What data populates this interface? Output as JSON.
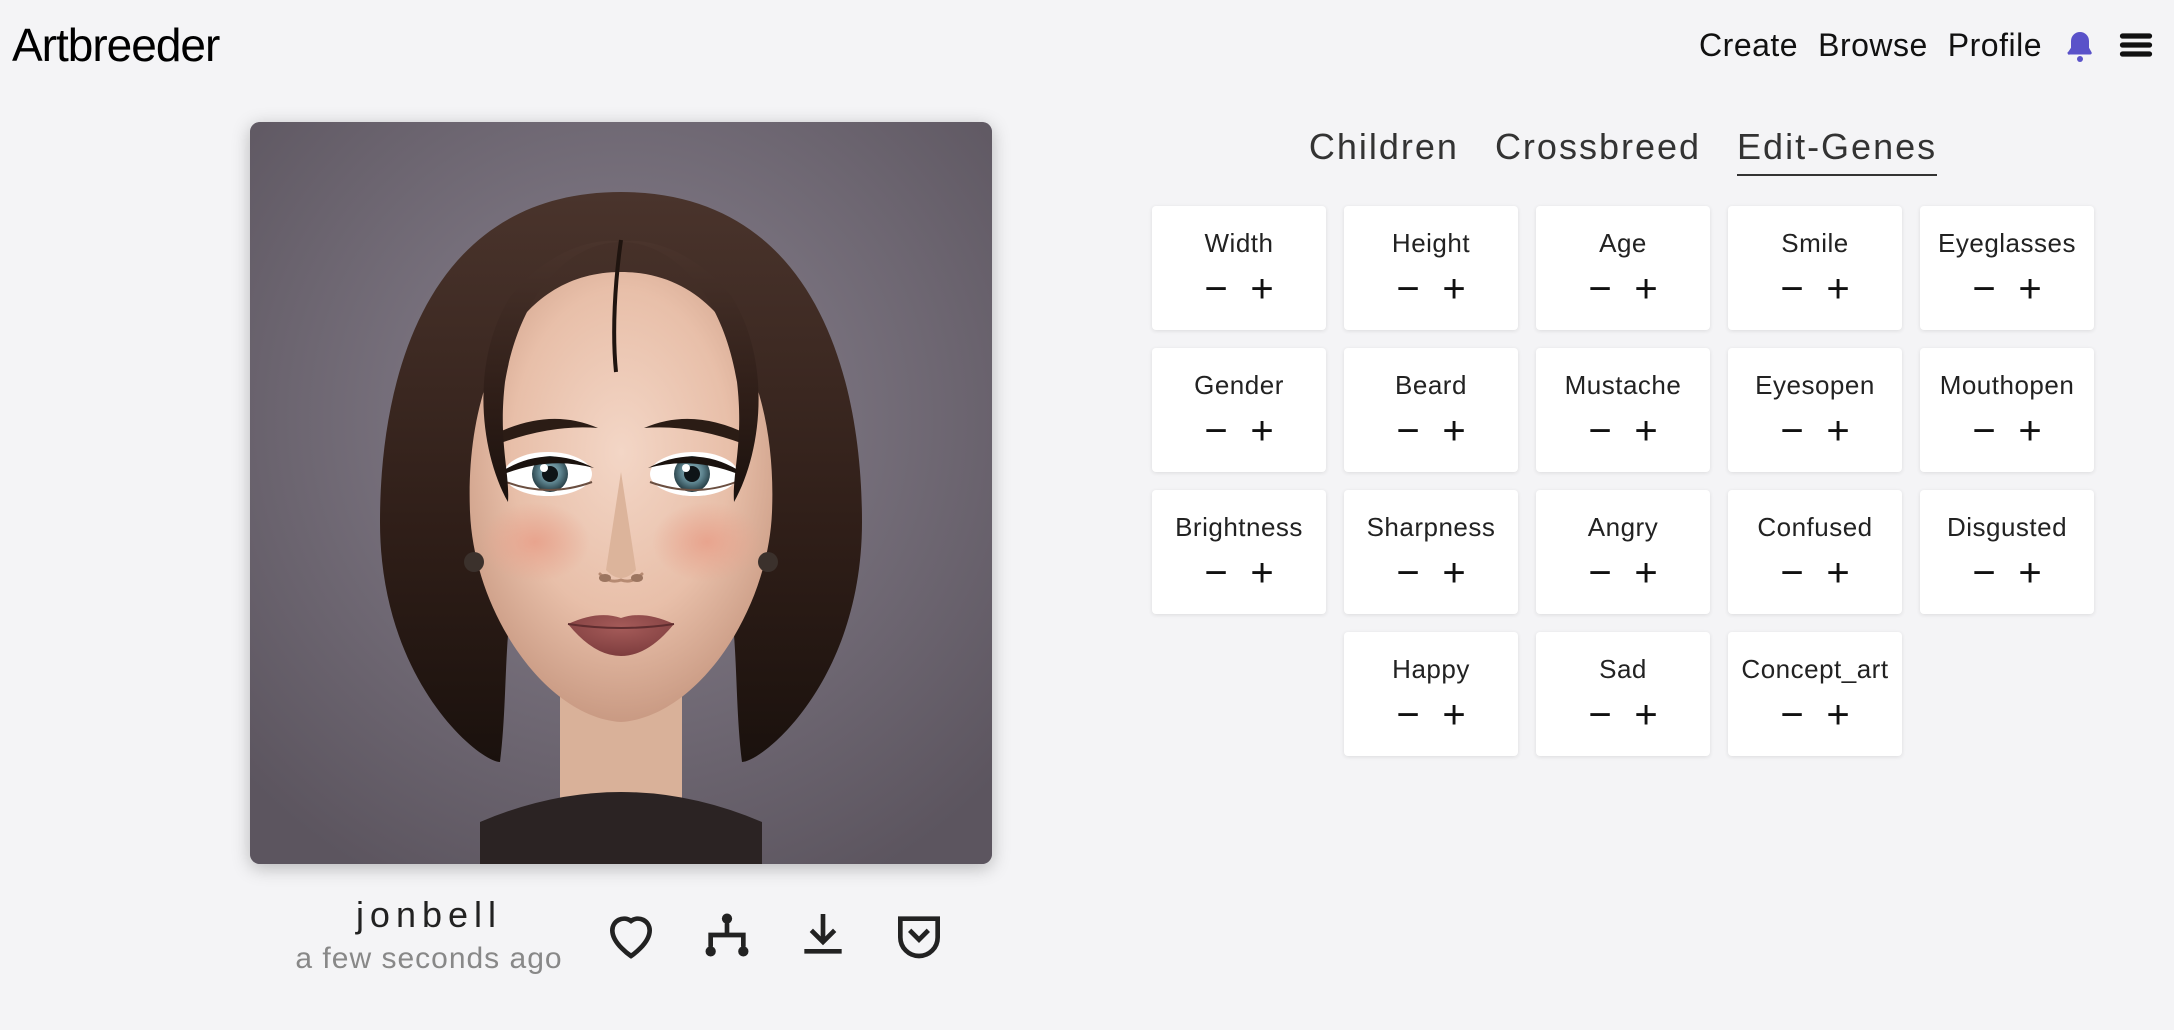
{
  "header": {
    "logo": "Artbreeder",
    "nav": {
      "create": "Create",
      "browse": "Browse",
      "profile": "Profile"
    }
  },
  "image": {
    "username": "jonbell",
    "timestamp": "a few seconds ago"
  },
  "tabs": {
    "children": "Children",
    "crossbreed": "Crossbreed",
    "edit_genes": "Edit-Genes",
    "active": "edit_genes"
  },
  "genes": [
    {
      "label": "Width"
    },
    {
      "label": "Height"
    },
    {
      "label": "Age"
    },
    {
      "label": "Smile"
    },
    {
      "label": "Eyeglasses"
    },
    {
      "label": "Gender"
    },
    {
      "label": "Beard"
    },
    {
      "label": "Mustache"
    },
    {
      "label": "Eyesopen"
    },
    {
      "label": "Mouthopen"
    },
    {
      "label": "Brightness"
    },
    {
      "label": "Sharpness"
    },
    {
      "label": "Angry"
    },
    {
      "label": "Confused"
    },
    {
      "label": "Disgusted"
    },
    {
      "label": "Happy"
    },
    {
      "label": "Sad"
    },
    {
      "label": "Concept_art"
    }
  ]
}
